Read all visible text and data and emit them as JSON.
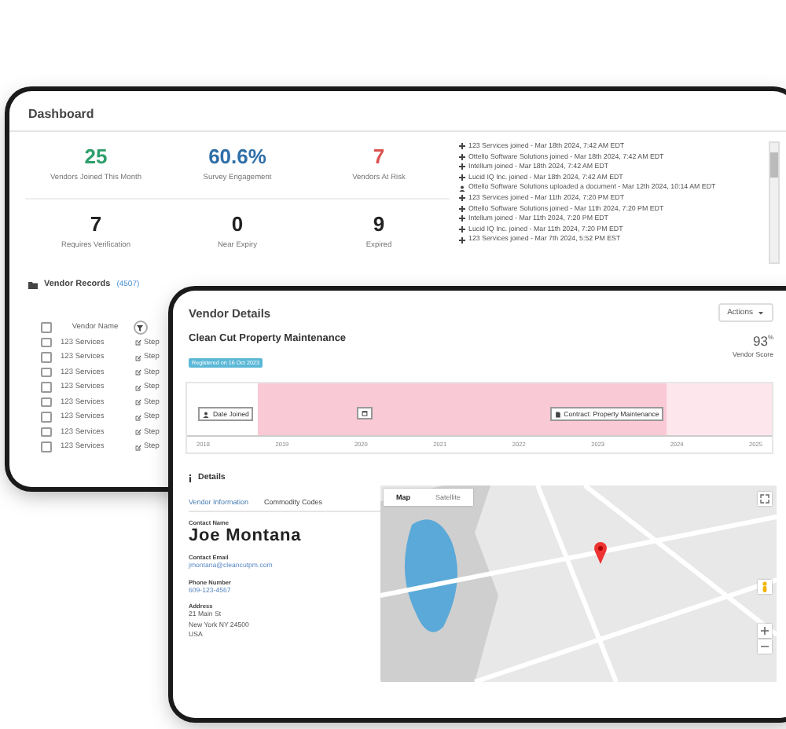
{
  "dashboard": {
    "title": "Dashboard",
    "stats": [
      {
        "value": "25",
        "label": "Vendors Joined This Month",
        "color": "#2e9e6b"
      },
      {
        "value": "60.6%",
        "label": "Survey Engagement",
        "color": "#2f6fa8"
      },
      {
        "value": "7",
        "label": "Vendors At Risk",
        "color": "#d9534f"
      },
      {
        "value": "7",
        "label": "Requires Verification",
        "color": "#222222"
      },
      {
        "value": "0",
        "label": "Near Expiry",
        "color": "#222222"
      },
      {
        "value": "9",
        "label": "Expired",
        "color": "#222222"
      }
    ],
    "activity": [
      {
        "kind": "join",
        "text": "123 Services joined - Mar 18th 2024, 7:42 AM EDT"
      },
      {
        "kind": "join",
        "text": "Ottello Software Solutions joined - Mar 18th 2024, 7:42 AM EDT"
      },
      {
        "kind": "join",
        "text": "Intellum joined - Mar 18th 2024, 7:42 AM EDT"
      },
      {
        "kind": "join",
        "text": "Lucid IQ Inc. joined - Mar 18th 2024, 7:42 AM EDT"
      },
      {
        "kind": "upload",
        "text": "Ottello Software Solutions uploaded a document - Mar 12th 2024, 10:14 AM EDT"
      },
      {
        "kind": "join",
        "text": "123 Services joined - Mar 11th 2024, 7:20 PM EDT"
      },
      {
        "kind": "join",
        "text": "Ottello Software Solutions joined - Mar 11th 2024, 7:20 PM EDT"
      },
      {
        "kind": "join",
        "text": "Intellum joined - Mar 11th 2024, 7:20 PM EDT"
      },
      {
        "kind": "join",
        "text": "Lucid IQ Inc. joined - Mar 11th 2024, 7:20 PM EDT"
      },
      {
        "kind": "join",
        "text": "123 Services joined - Mar 7th 2024, 5:52 PM EST"
      }
    ],
    "records": {
      "title": "Vendor Records",
      "count": "(4507)",
      "column": "Vendor Name",
      "all_checked": false,
      "rows": [
        {
          "checked": false,
          "name": "123 Services",
          "column_2": "Step"
        },
        {
          "checked": false,
          "name": "123 Services",
          "column_2": "Step"
        },
        {
          "checked": false,
          "name": "123 Services",
          "column_2": "Step"
        },
        {
          "checked": false,
          "name": "123 Services",
          "column_2": "Step"
        },
        {
          "checked": false,
          "name": "123 Services",
          "column_2": "Step"
        },
        {
          "checked": false,
          "name": "123 Services",
          "column_2": "Step"
        },
        {
          "checked": false,
          "name": "123 Services",
          "column_2": "Step"
        },
        {
          "checked": false,
          "name": "123 Services",
          "column_2": "Step"
        }
      ]
    }
  },
  "vendor": {
    "title": "Vendor Details",
    "actions": "Actions",
    "company": "Clean Cut Property Maintenance",
    "badge": "Registered on 16 Oct 2023",
    "score": "93",
    "score_unit": "%",
    "score_label": "Vendor Score",
    "timeline": {
      "years": [
        "2018",
        "2019",
        "2020",
        "2021",
        "2022",
        "2023",
        "2024",
        "2025"
      ],
      "events": [
        {
          "kind": "joined",
          "label": "Date Joined"
        },
        {
          "kind": "document"
        },
        {
          "kind": "contract",
          "label": "Contract: Property Maintenance"
        }
      ]
    },
    "details": {
      "title": "Details",
      "tabs": [
        {
          "label": "Vendor Information",
          "selected": true
        },
        {
          "label": "Commodity Codes",
          "selected": false
        }
      ],
      "fields": [
        {
          "kind": "name",
          "label": "Contact Name",
          "lines": [
            "Joe Montana"
          ]
        },
        {
          "kind": "link",
          "label": "Contact Email",
          "lines": [
            "jmontana@cleancutpm.com"
          ]
        },
        {
          "kind": "link",
          "label": "Phone Number",
          "lines": [
            "609-123-4567"
          ]
        },
        {
          "kind": "text",
          "label": "Address",
          "lines": [
            "21 Main St",
            "New York NY 24500",
            "USA"
          ]
        }
      ],
      "map_tabs": [
        {
          "label": "Map",
          "selected": true
        },
        {
          "label": "Satellite",
          "selected": false
        }
      ]
    }
  }
}
